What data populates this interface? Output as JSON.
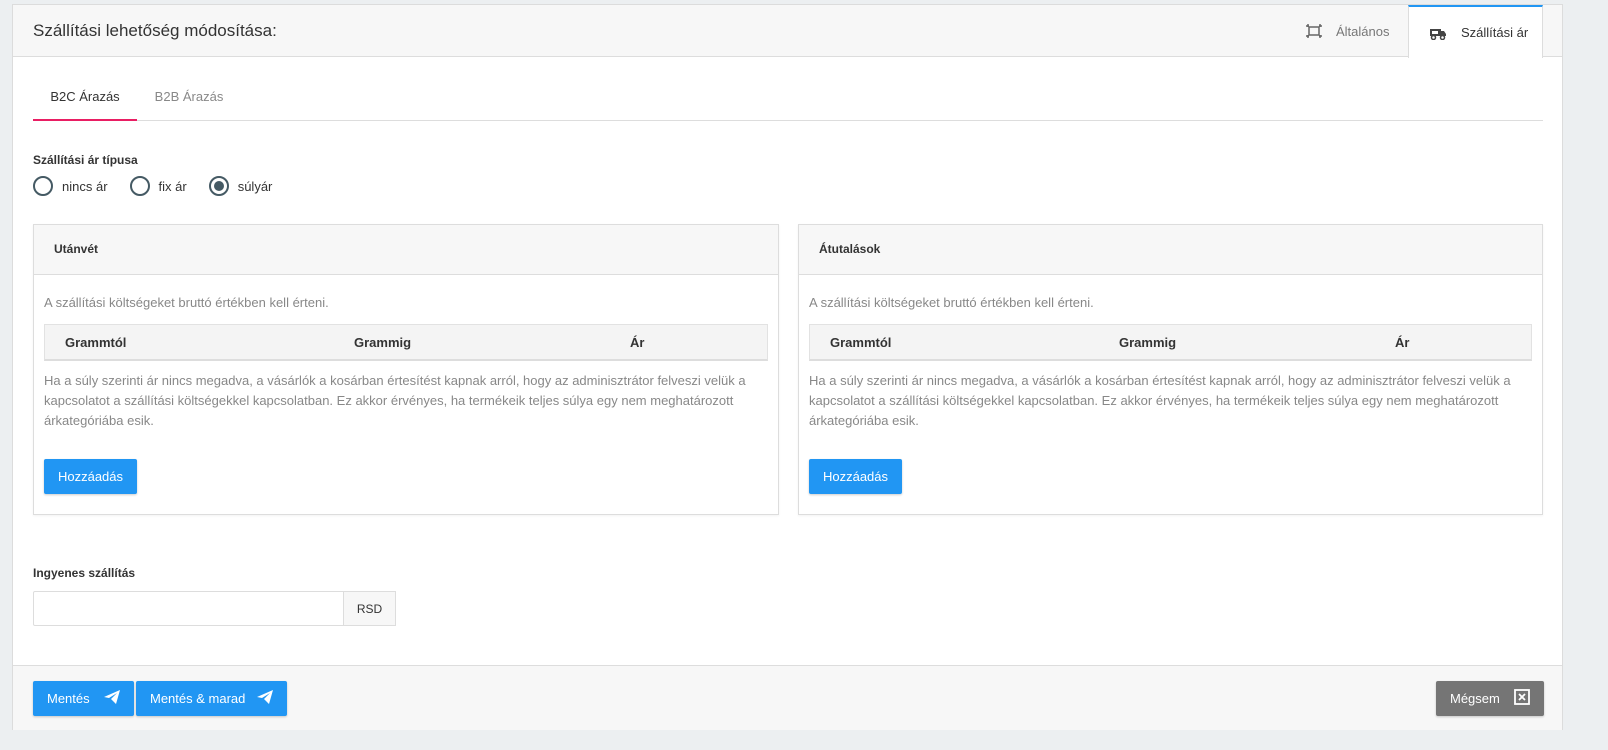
{
  "header": {
    "title": "Szállítási lehetőség módosítása:",
    "tabs": [
      {
        "label": "Általános",
        "icon": "frame-icon"
      },
      {
        "label": "Szállítási ár",
        "icon": "truck-icon"
      }
    ]
  },
  "subtabs": [
    {
      "label": "B2C Árazás"
    },
    {
      "label": "B2B Árazás"
    }
  ],
  "price_type": {
    "label": "Szállítási ár típusa",
    "options": [
      {
        "label": "nincs ár"
      },
      {
        "label": "fix ár"
      },
      {
        "label": "súlyár"
      }
    ],
    "selected": "súlyár"
  },
  "panels": [
    {
      "title": "Utánvét",
      "note": "A szállítási költségeket bruttó értékben kell érteni.",
      "columns": [
        "Grammtól",
        "Grammig",
        "Ár"
      ],
      "info": "Ha a súly szerinti ár nincs megadva, a vásárlók a kosárban értesítést kapnak arról, hogy az adminisztrátor felveszi velük a kapcsolatot a szállítási költségekkel kapcsolatban. Ez akkor érvényes, ha termékeik teljes súlya egy nem meghatározott árkategóriába esik.",
      "add_label": "Hozzáadás"
    },
    {
      "title": "Átutalások",
      "note": "A szállítási költségeket bruttó értékben kell érteni.",
      "columns": [
        "Grammtól",
        "Grammig",
        "Ár"
      ],
      "info": "Ha a súly szerinti ár nincs megadva, a vásárlók a kosárban értesítést kapnak arról, hogy az adminisztrátor felveszi velük a kapcsolatot a szállítási költségekkel kapcsolatban. Ez akkor érvényes, ha termékeik teljes súlya egy nem meghatározott árkategóriába esik.",
      "add_label": "Hozzáadás"
    }
  ],
  "free_shipping": {
    "label": "Ingyenes szállítás",
    "value": "",
    "currency": "RSD"
  },
  "footer": {
    "save_label": "Mentés",
    "save_stay_label": "Mentés & marad",
    "cancel_label": "Mégsem"
  },
  "colors": {
    "primary": "#2196f3",
    "active_subtab": "#e91e63",
    "cancel": "#757575"
  }
}
